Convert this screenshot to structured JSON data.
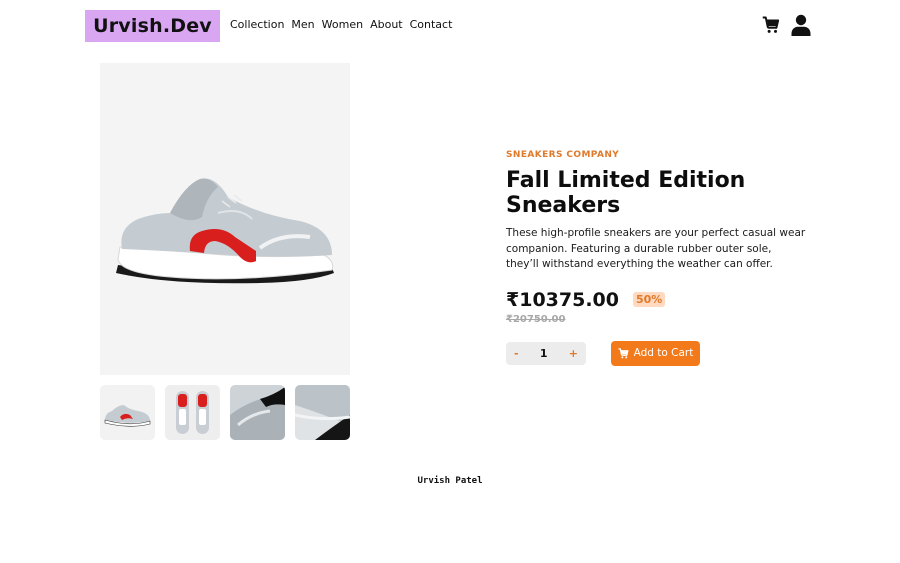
{
  "brand": {
    "logo_text": "Urvish.Dev",
    "logo_bg": "#d9a6f2"
  },
  "nav": {
    "links": [
      "Collection",
      "Men",
      "Women",
      "About",
      "Contact"
    ]
  },
  "header_icons": [
    "cart-icon",
    "user-icon"
  ],
  "product": {
    "company": "SNEAKERS COMPANY",
    "title": "Fall Limited Edition Sneakers",
    "description": "These high-profile sneakers are your perfect casual wear companion. Featuring a durable rubber outer sole, they’ll withstand everything the weather can offer.",
    "price": "₹10375.00",
    "discount": "50%",
    "original_price": "₹20750.00",
    "quantity": "1",
    "decrement_label": "-",
    "increment_label": "+",
    "add_to_cart_label": "Add to Cart",
    "thumbnails": [
      "side view",
      "top view",
      "heel close-up",
      "toe close-up"
    ]
  },
  "colors": {
    "accent": "#f27a1a",
    "accent_text": "#e07a2b",
    "badge_bg": "#ffd9c0"
  },
  "footer": {
    "text": "Urvish Patel"
  }
}
